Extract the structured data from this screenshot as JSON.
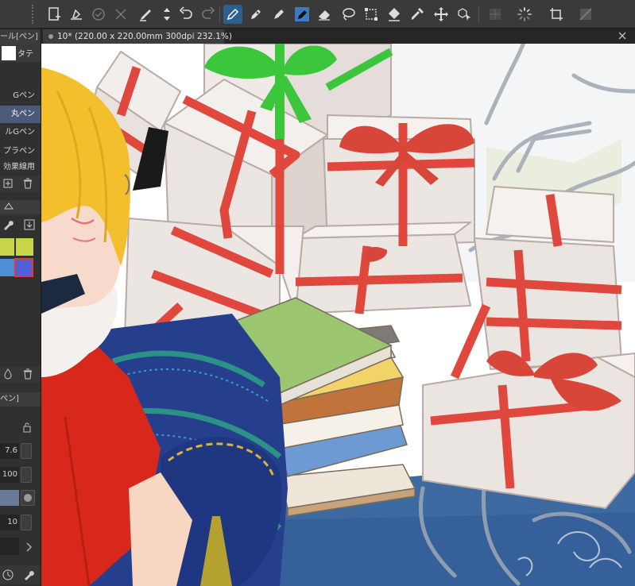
{
  "document_tab": {
    "title": "10* (220.00 x 220.00mm 300dpi 232.1%)"
  },
  "left_panel": {
    "panel_title": "ール[ペン]",
    "brush_preview_label": "タテ",
    "pen_list": [
      "Gペン",
      "丸ペン",
      "ルGペン",
      "プラペン",
      "効果線用"
    ],
    "tool_property_title": "ペン]",
    "size_values": [
      "7.6",
      "100",
      "10"
    ]
  },
  "colors": {
    "swatch_1": "#c8d44a",
    "swatch_2": "#c8d44a",
    "swatch_3": "#4e8fd6",
    "swatch_4": "#5060d8",
    "ribbon_red": "#e0473d",
    "ribbon_green": "#3cc63c",
    "box_fill": "#ebe4e1",
    "hair": "#f3bf2c",
    "coat": "#d8281c"
  },
  "toolbar": {
    "icons": [
      "new-canvas-icon",
      "clear-layer-icon",
      "confirm-icon",
      "cancel-icon",
      "brush-icon",
      "transform-icon",
      "undo-icon",
      "redo-icon",
      "pen-icon",
      "pencil-icon",
      "marker-icon",
      "ink-pen-icon",
      "eraser-icon",
      "lasso-icon",
      "select-icon",
      "fill-icon",
      "eyedropper-icon",
      "move-icon",
      "object-select-icon",
      "grid-icon",
      "loading-icon",
      "crop-icon",
      "gradient-icon"
    ]
  }
}
